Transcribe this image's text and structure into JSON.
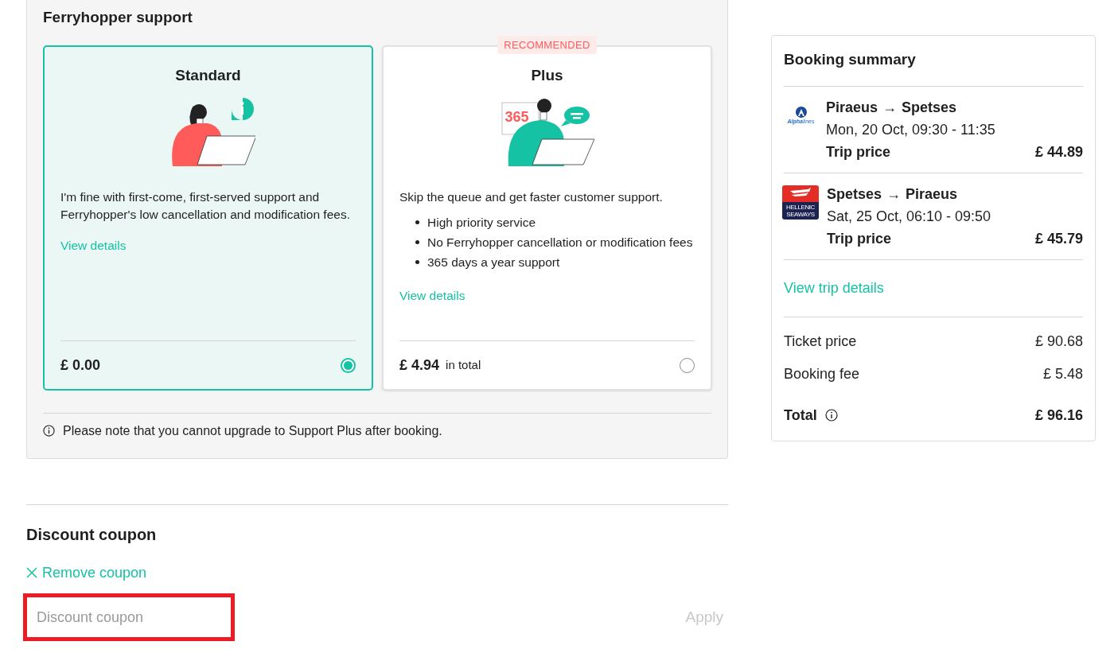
{
  "support": {
    "title": "Ferryhopper support",
    "plans": [
      {
        "kind": "standard",
        "name": "Standard",
        "description": "I'm fine with first-come, first-served support and Ferryhopper's low cancellation and modification fees.",
        "link": "View details",
        "price": "£ 0.00",
        "selected": true
      },
      {
        "kind": "plus",
        "name": "Plus",
        "badge": "RECOMMENDED",
        "illustration_text": "365",
        "description": "Skip the queue and get faster customer support.",
        "features": [
          "High priority service",
          "No Ferryhopper cancellation or modification fees",
          "365 days a year support"
        ],
        "link": "View details",
        "price": "£ 4.94",
        "price_note": "in total",
        "selected": false
      }
    ],
    "note": "Please note that you cannot upgrade to Support Plus after booking."
  },
  "coupon": {
    "title": "Discount coupon",
    "remove": "Remove coupon",
    "placeholder": "Discount coupon",
    "highlighted": true,
    "apply": "Apply"
  },
  "summary": {
    "title": "Booking summary",
    "trips": [
      {
        "kind": "alphalines",
        "logo_text": [
          "Alpha",
          "lines"
        ],
        "from": "Piraeus",
        "arrow": "→",
        "to": "Spetses",
        "when": "Mon, 20 Oct, 09:30 - 11:35",
        "price_label": "Trip price",
        "price": "£ 44.89"
      },
      {
        "kind": "hellenic",
        "logo_text": [
          "HELLENIC",
          "SEAWAYS"
        ],
        "from": "Spetses",
        "arrow": "→",
        "to": "Piraeus",
        "when": "Sat, 25 Oct, 06:10 - 09:50",
        "price_label": "Trip price",
        "price": "£ 45.79"
      }
    ],
    "details_link": "View trip details",
    "lines": [
      {
        "label": "Ticket price",
        "value": "£ 90.68"
      },
      {
        "label": "Booking fee",
        "value": "£ 5.48"
      }
    ],
    "total": {
      "label": "Total",
      "value": "£ 96.16"
    }
  }
}
